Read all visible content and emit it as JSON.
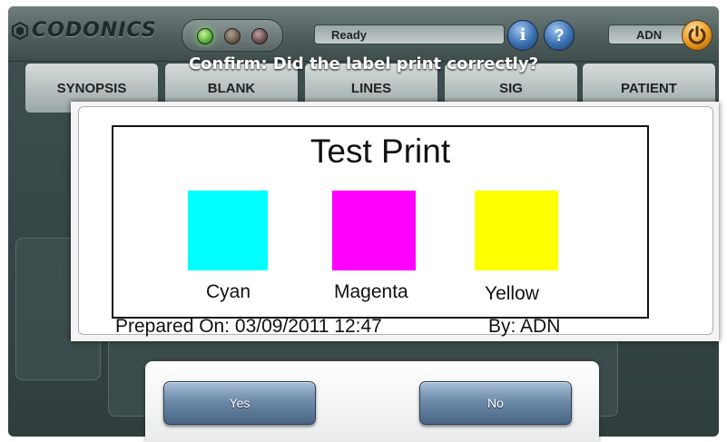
{
  "header": {
    "brand": "CODONICS",
    "status_text": "Ready",
    "user": "ADN",
    "info_glyph": "i",
    "help_glyph": "?"
  },
  "icons": {
    "logo": "codonics-hex-logo-icon",
    "info": "info-icon",
    "help": "help-icon",
    "power": "power-icon"
  },
  "status_lights": [
    {
      "name": "ready-light",
      "color": "#58b038",
      "on": true
    },
    {
      "name": "warning-light",
      "color": "#6a5a4a",
      "on": false
    },
    {
      "name": "error-light",
      "color": "#6a4a4a",
      "on": false
    }
  ],
  "tabs": [
    {
      "label": "SYNOPSIS"
    },
    {
      "label": "BLANK"
    },
    {
      "label": "LINES"
    },
    {
      "label": "SIG"
    },
    {
      "label": "PATIENT"
    }
  ],
  "dialog": {
    "prompt": "Confirm: Did the label print correctly?",
    "label": {
      "title": "Test Print",
      "swatches": [
        {
          "name": "Cyan",
          "color": "#00ffff"
        },
        {
          "name": "Magenta",
          "color": "#ff00ff"
        },
        {
          "name": "Yellow",
          "color": "#ffff00"
        }
      ],
      "prepared_on": "Prepared On:  03/09/2011 12:47",
      "prepared_by": "By: ADN"
    },
    "buttons": {
      "yes": "Yes",
      "no": "No"
    }
  }
}
